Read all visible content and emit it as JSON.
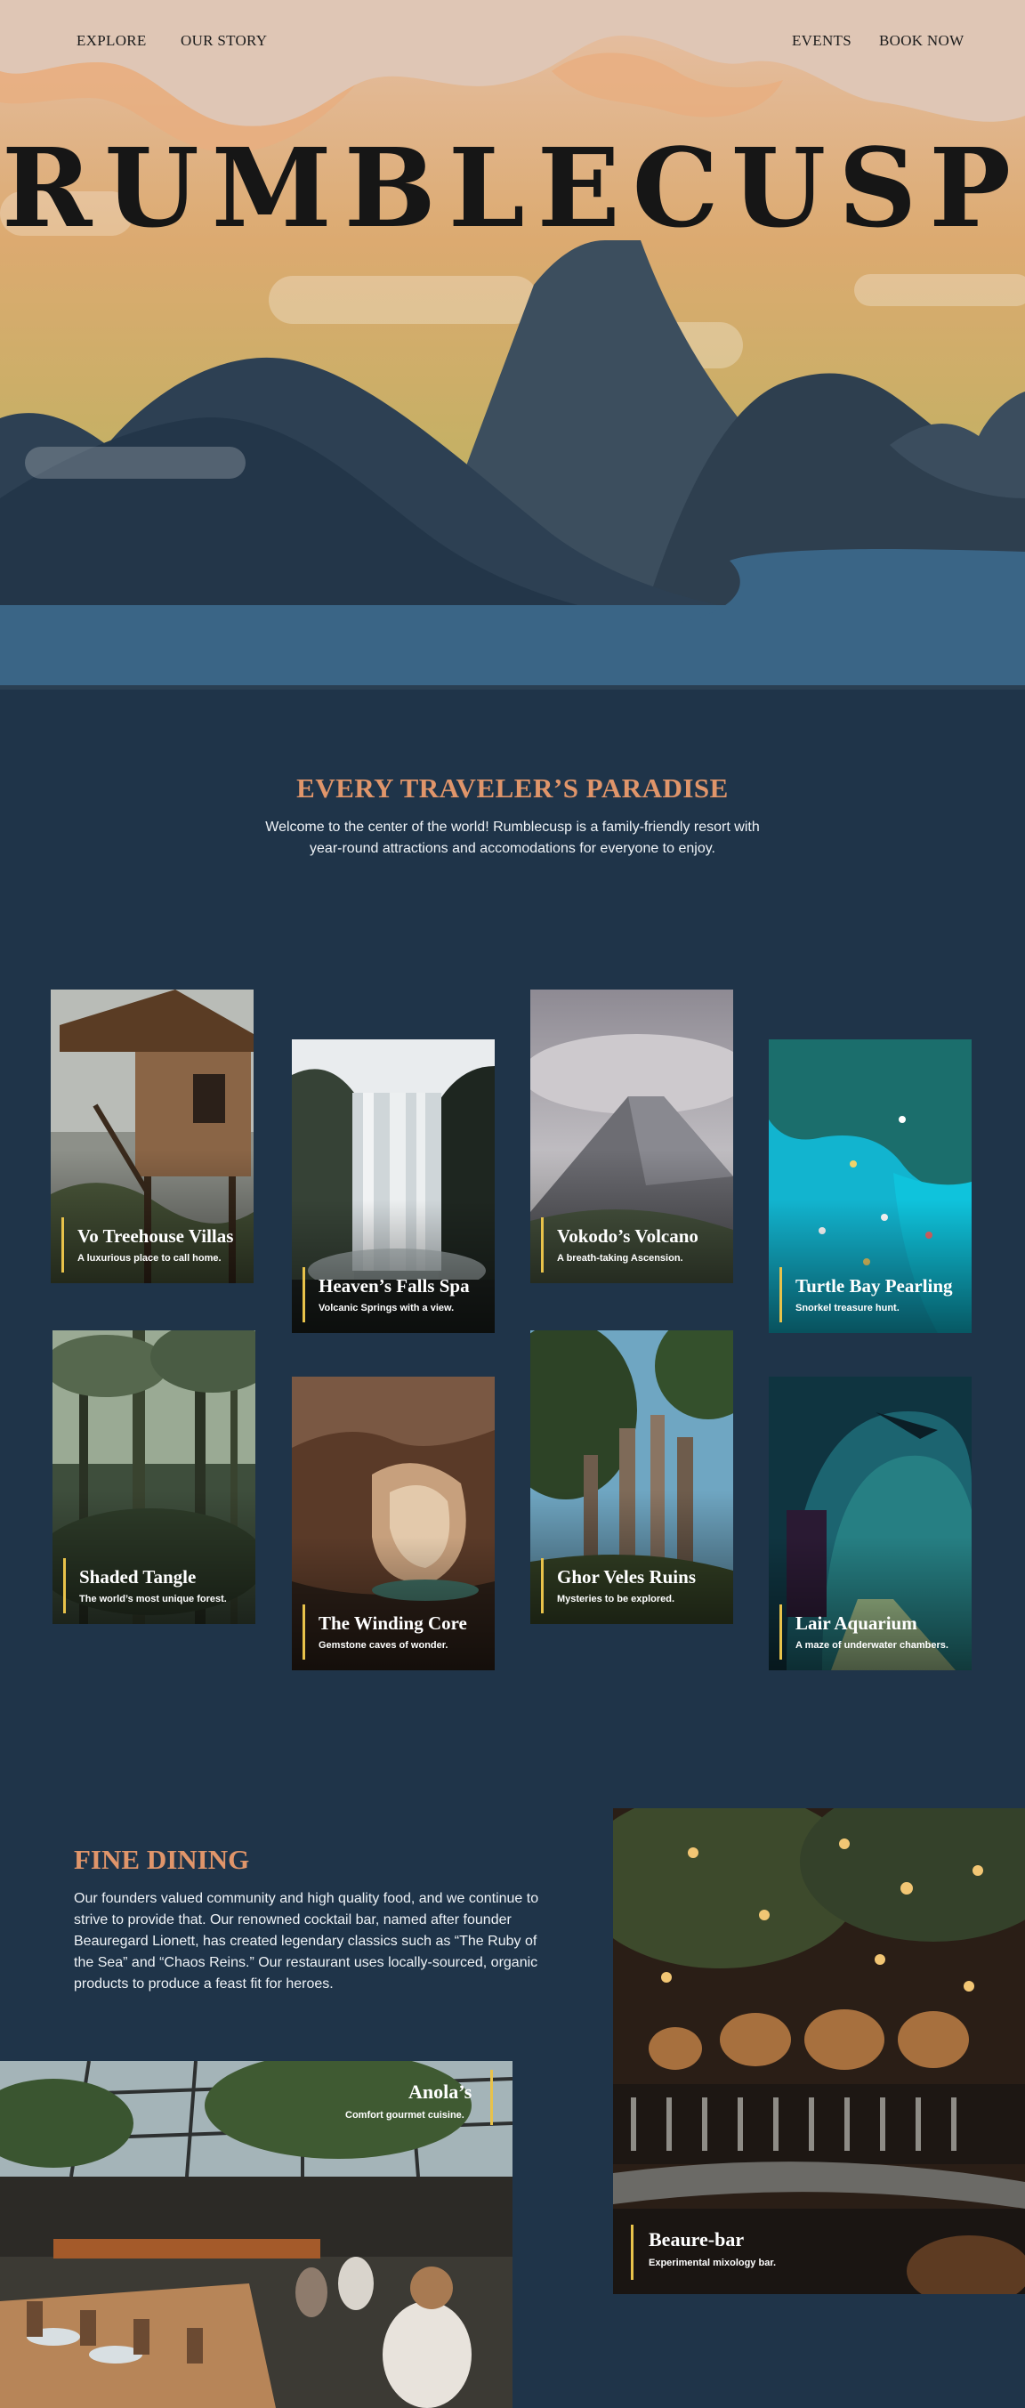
{
  "nav": {
    "explore": "EXPLORE",
    "our_story": "OUR STORY",
    "events": "EVENTS",
    "book_now": "BOOK NOW"
  },
  "hero": {
    "title": "RUMBLECUSP"
  },
  "intro": {
    "heading": "EVERY TRAVELER’S PARADISE",
    "text": "Welcome to the center of the world! Rumblecusp is a family-friendly resort with year-round attractions and accomodations for everyone to enjoy."
  },
  "attractions": [
    {
      "title": "Vo Treehouse Villas",
      "subtitle": "A luxurious place to call home."
    },
    {
      "title": "Heaven’s Falls Spa",
      "subtitle": "Volcanic Springs with a view."
    },
    {
      "title": "Vokodo’s Volcano",
      "subtitle": "A breath-taking Ascension."
    },
    {
      "title": "Turtle Bay Pearling",
      "subtitle": "Snorkel treasure hunt."
    },
    {
      "title": "Shaded Tangle",
      "subtitle": "The world’s most unique forest."
    },
    {
      "title": "The Winding Core",
      "subtitle": "Gemstone caves of wonder."
    },
    {
      "title": "Ghor Veles Ruins",
      "subtitle": "Mysteries to be explored."
    },
    {
      "title": "Lair Aquarium",
      "subtitle": "A maze of underwater chambers."
    }
  ],
  "dining": {
    "heading": "FINE DINING",
    "text": "Our founders valued community and high quality food, and we continue to strive to provide that. Our renowned cocktail bar, named after founder Beauregard Lionett, has created legendary classics such as “The Ruby of the Sea” and “Chaos Reins.” Our restaurant uses locally-sourced, organic products to produce a feast fit for heroes.",
    "venues": [
      {
        "title": "Beaure-bar",
        "subtitle": "Experimental mixology bar."
      },
      {
        "title": "Anola’s",
        "subtitle": "Comfort gourmet cuisine."
      }
    ]
  },
  "colors": {
    "background": "#1f3449",
    "accent_heading": "#e0956a",
    "card_bar": "#e8c24a",
    "sky_top": "#dec7b6",
    "sky_mid": "#d8a86a",
    "sky_bottom": "#b9b062",
    "water": "#3a6586"
  }
}
